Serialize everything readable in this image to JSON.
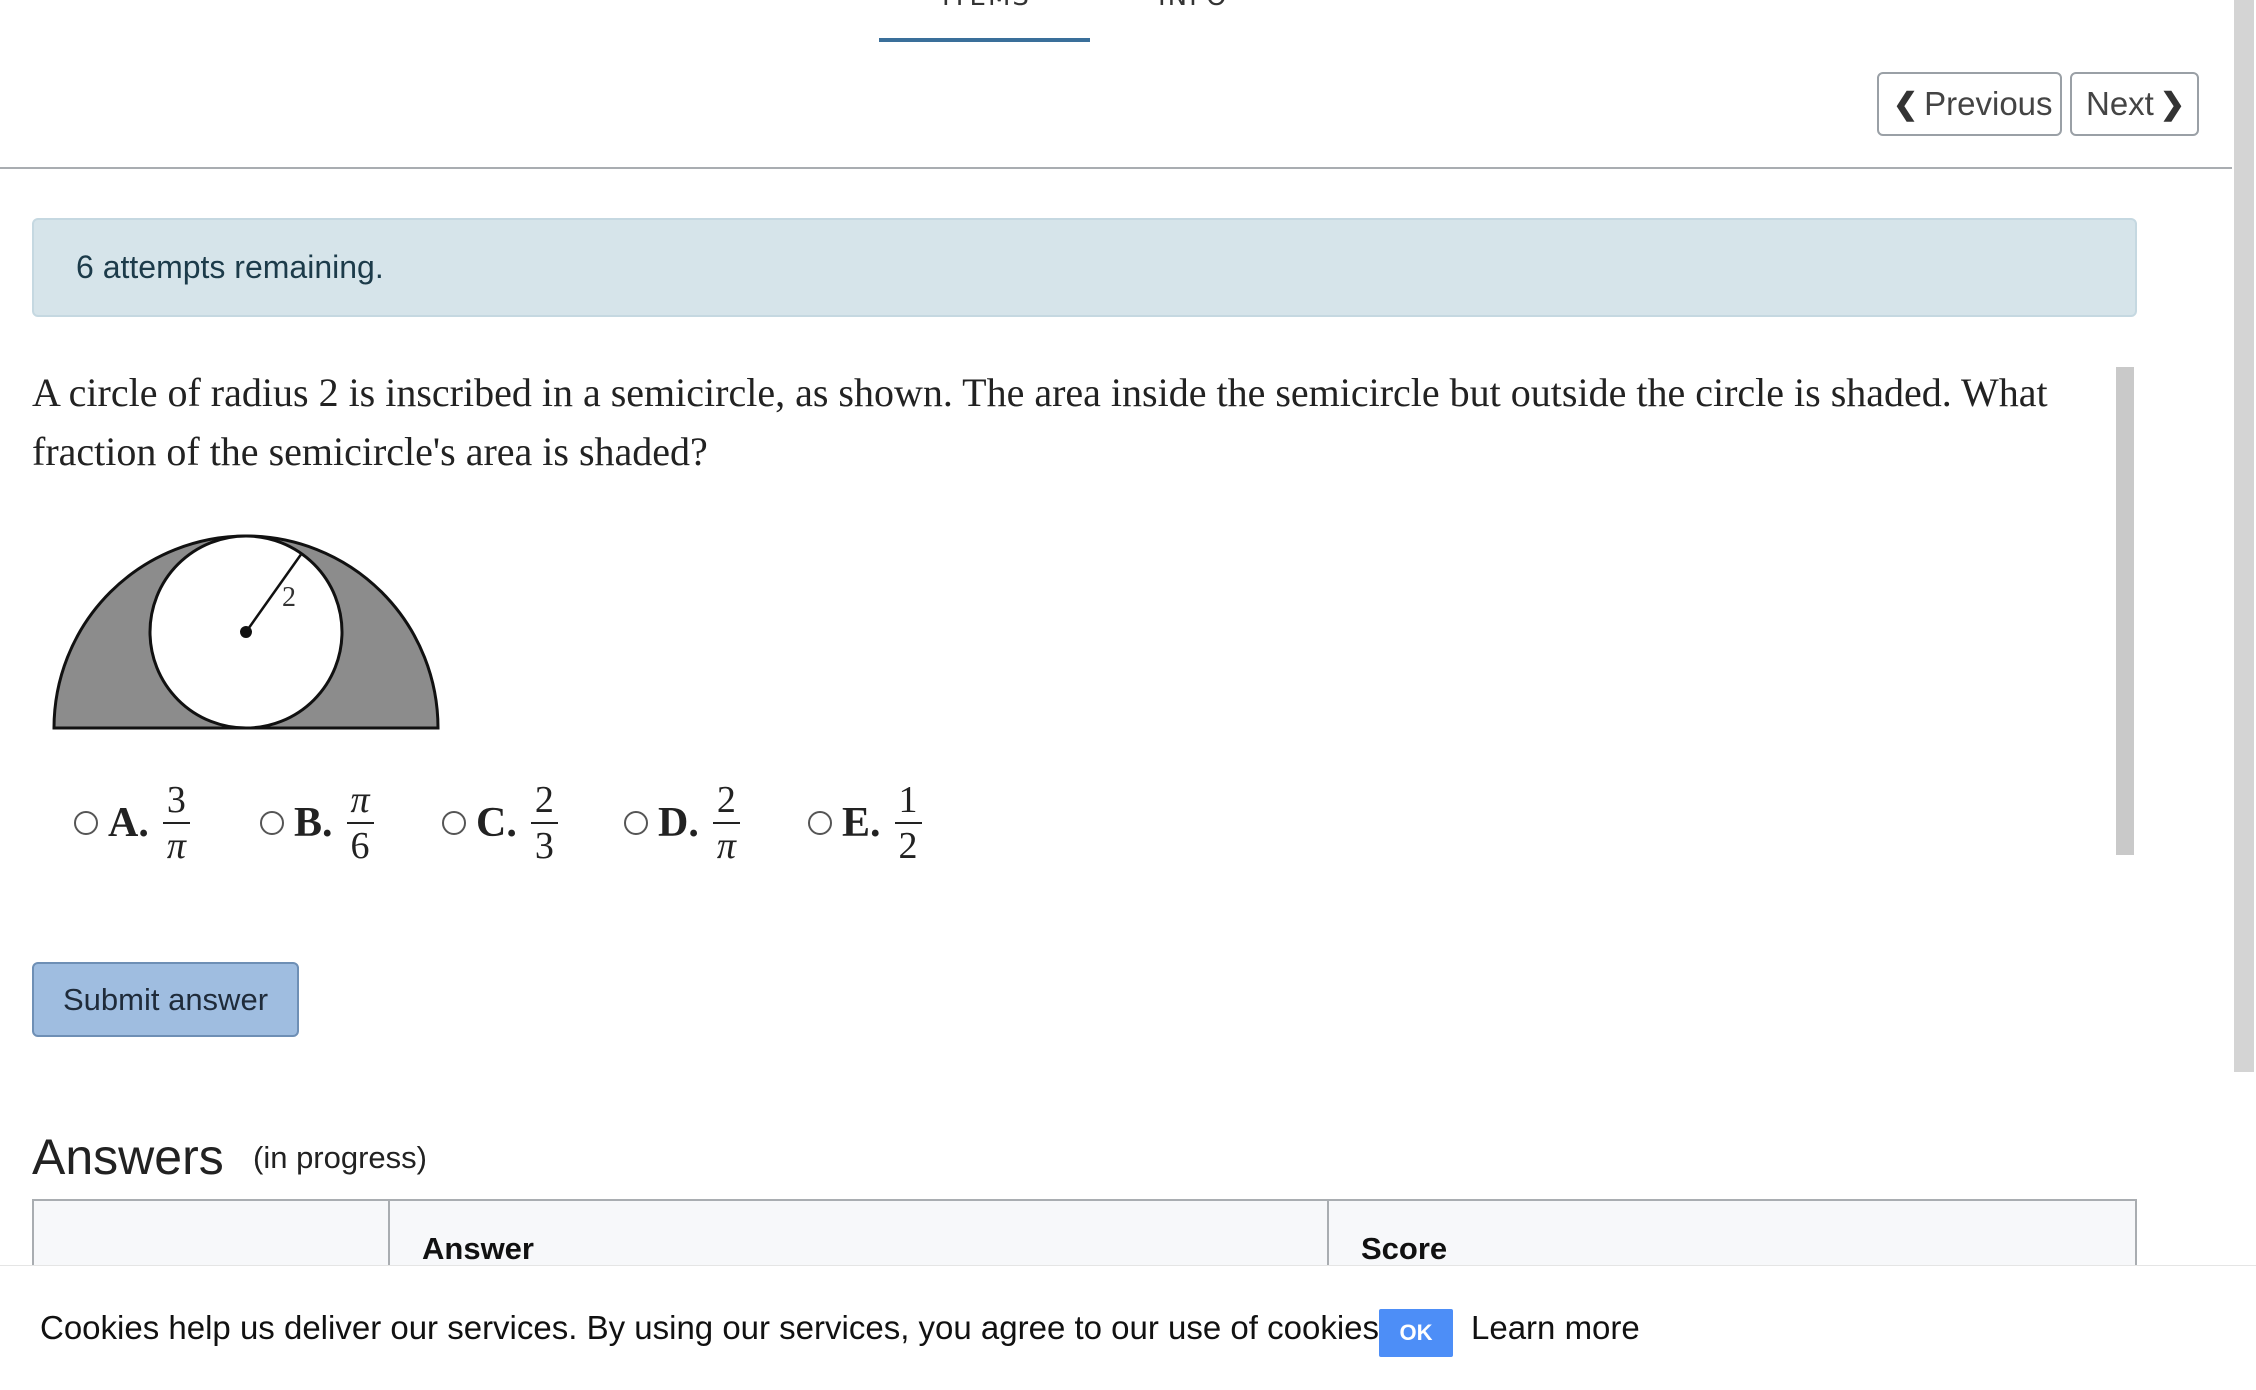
{
  "tabs": {
    "items_label": "ITEMS",
    "info_label": "INFO"
  },
  "nav": {
    "previous_label": "Previous",
    "next_label": "Next"
  },
  "alert": {
    "text": "6 attempts remaining."
  },
  "question": {
    "text": "A circle of radius 2 is inscribed in a semicircle, as shown. The area inside the semicircle but outside the circle is shaded. What fraction of the semicircle's area is shaded?",
    "figure_radius_label": "2"
  },
  "choices": [
    {
      "letter": "A.",
      "numerator": "3",
      "denominator": "π"
    },
    {
      "letter": "B.",
      "numerator": "π",
      "denominator": "6"
    },
    {
      "letter": "C.",
      "numerator": "2",
      "denominator": "3"
    },
    {
      "letter": "D.",
      "numerator": "2",
      "denominator": "π"
    },
    {
      "letter": "E.",
      "numerator": "1",
      "denominator": "2"
    }
  ],
  "submit_label": "Submit answer",
  "answers": {
    "title": "Answers",
    "status": "(in progress)",
    "columns": [
      "",
      "Answer",
      "Score"
    ]
  },
  "cookie": {
    "text": "Cookies help us deliver our services. By using our services, you agree to our use of cookies.",
    "ok_label": "OK",
    "learn_more_label": "Learn more"
  },
  "colors": {
    "accent": "#3a6f9a",
    "alert_bg": "#d6e4ea",
    "submit_bg": "#9fbde0",
    "shade": "#8c8c8c",
    "cookie_ok": "#4d8ef7"
  }
}
